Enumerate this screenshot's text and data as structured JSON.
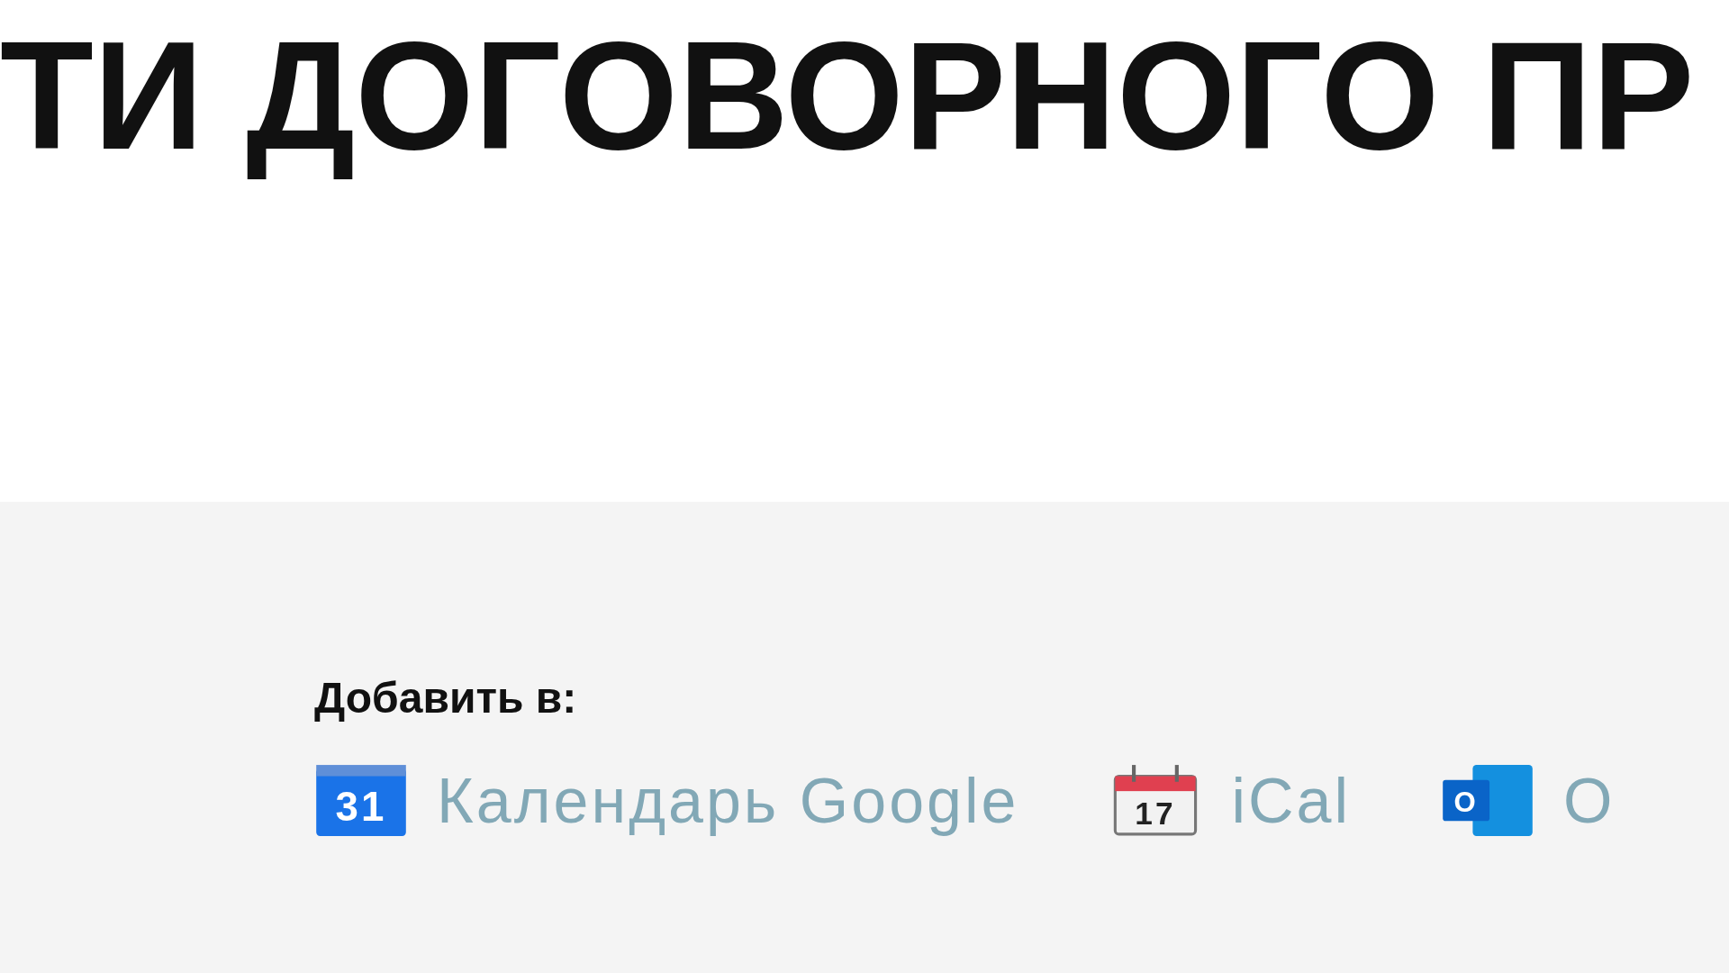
{
  "heading": "ТИ ДОГОВОРНОГО ПР",
  "calendar": {
    "label": "Добавить в:",
    "links": [
      {
        "kind": "google",
        "label": "Календарь Google",
        "icon_text": "31"
      },
      {
        "kind": "ical",
        "label": "iCal",
        "icon_text": "17"
      },
      {
        "kind": "outlook",
        "label": "О",
        "icon_text": "O"
      }
    ]
  }
}
